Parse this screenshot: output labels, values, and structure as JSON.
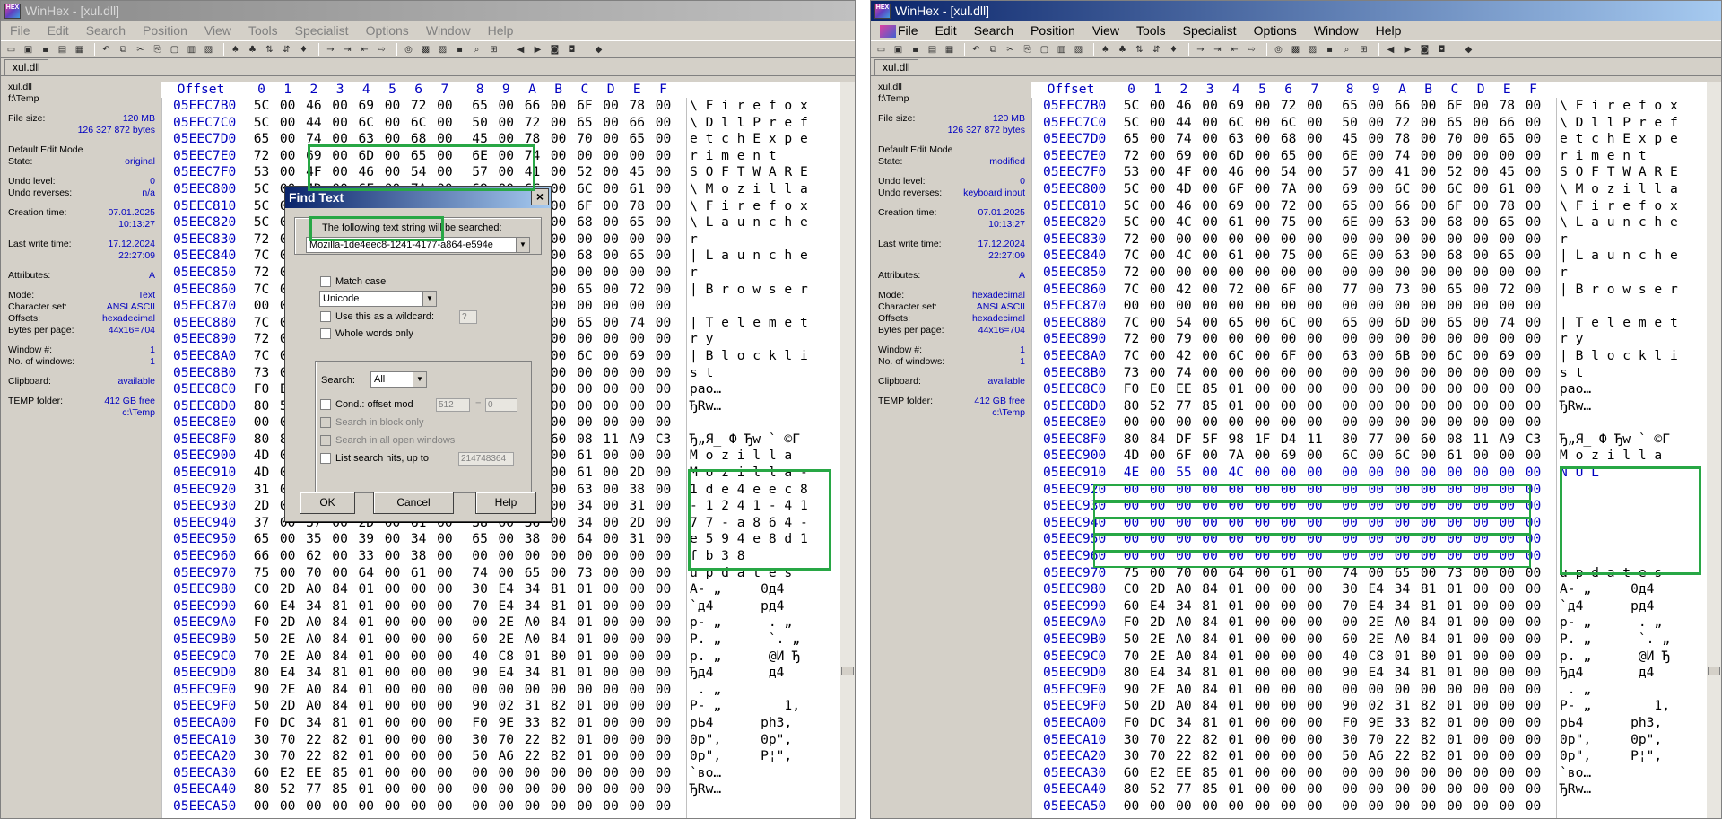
{
  "left": {
    "title": "WinHex - [xul.dll]",
    "menu": [
      "File",
      "Edit",
      "Search",
      "Position",
      "View",
      "Tools",
      "Specialist",
      "Options",
      "Window",
      "Help"
    ],
    "tab": "xul.dll",
    "info": {
      "file": "xul.dll",
      "folder": "f:\\Temp",
      "file_size_label": "File size:",
      "file_size_mb": "120 MB",
      "file_size_bytes": "126 327 872 bytes",
      "edit_mode_label": "Default Edit Mode",
      "state_label": "State:",
      "state": "original",
      "undo_level_label": "Undo level:",
      "undo_level": "0",
      "undo_reverses_label": "Undo reverses:",
      "undo_reverses": "n/a",
      "creation_label": "Creation time:",
      "creation_date": "07.01.2025",
      "creation_time": "10:13:27",
      "write_label": "Last write time:",
      "write_date": "17.12.2024",
      "write_time": "22:27:09",
      "attributes_label": "Attributes:",
      "attributes": "A",
      "mode_label": "Mode:",
      "mode": "Text",
      "charset_label": "Character set:",
      "charset": "ANSI ASCII",
      "offsets_label": "Offsets:",
      "offsets": "hexadecimal",
      "bpp_label": "Bytes per page:",
      "bpp": "44x16=704",
      "window_label": "Window #:",
      "window": "1",
      "nwin_label": "No. of windows:",
      "nwin": "1",
      "clipboard_label": "Clipboard:",
      "clipboard": "available",
      "temp_label": "TEMP folder:",
      "temp_free": "412 GB free",
      "temp_path": "c:\\Temp"
    },
    "header_offset": "Offset",
    "header_cols": [
      "0",
      "1",
      "2",
      "3",
      "4",
      "5",
      "6",
      "7",
      "8",
      "9",
      "A",
      "B",
      "C",
      "D",
      "E",
      "F"
    ],
    "rows": [
      {
        "off": "05EEC7B0",
        "hex": "5C 00 46 00 69 00 72 00 65 00 66 00 6F 00 78 00",
        "txt": "\\ F i r e f o x"
      },
      {
        "off": "05EEC7C0",
        "hex": "5C 00 44 00 6C 00 6C 00 50 00 72 00 65 00 66 00",
        "txt": "\\ D l l P r e f"
      },
      {
        "off": "05EEC7D0",
        "hex": "65 00 74 00 63 00 68 00 45 00 78 00 70 00 65 00",
        "txt": "e t c h E x p e"
      },
      {
        "off": "05EEC7E0",
        "hex": "72 00 69 00 6D 00 65 00 6E 00 74 00 00 00 00 00",
        "txt": "r i m e n t"
      },
      {
        "off": "05EEC7F0",
        "hex": "53 00 4F 00 46 00 54 00 57 00 41 00 52 00 45 00",
        "txt": "S O F T W A R E"
      },
      {
        "off": "05EEC800",
        "hex": "5C 00 4D 00 6F 00 7A 00 69 00 6C 00 6C 00 61 00",
        "txt": "\\ M o z i l l a"
      },
      {
        "off": "05EEC810",
        "hex": "5C 00 46 00 69 00 72 00 65 00 66 00 6F 00 78 00",
        "txt": "\\ F i r e f o x"
      },
      {
        "off": "05EEC820",
        "hex": "5C 00 4C 00 61 00 75 00 6E 00 63 00 68 00 65 00",
        "txt": "\\ L a u n c h e"
      },
      {
        "off": "05EEC830",
        "hex": "72 00 00 00 00 00 00 00 00 00 00 00 00 00 00 00",
        "txt": "r"
      },
      {
        "off": "05EEC840",
        "hex": "7C 00 4C 00 61 00 75 00 6E 00 63 00 68 00 65 00",
        "txt": "| L a u n c h e"
      },
      {
        "off": "05EEC850",
        "hex": "72 00 00 00 00 00 00 00 00 00 00 00 00 00 00 00",
        "txt": "r"
      },
      {
        "off": "05EEC860",
        "hex": "7C 00 42 00 72 00 6F 00 77 00 73 00 65 00 72 00",
        "txt": "| B r o w s e r"
      },
      {
        "off": "05EEC870",
        "hex": "00 00 00 00 00 00 00 00 00 00 00 00 00 00 00 00",
        "txt": ""
      },
      {
        "off": "05EEC880",
        "hex": "7C 00 54 00 65 00 6C 00 65 00 6D 00 65 00 74 00",
        "txt": "| T e l e m e t"
      },
      {
        "off": "05EEC890",
        "hex": "72 00 79 00 00 00 00 00 00 00 00 00 00 00 00 00",
        "txt": "r y"
      },
      {
        "off": "05EEC8A0",
        "hex": "7C 00 42 00 6C 00 6F 00 63 00 6B 00 6C 00 69 00",
        "txt": "| B l o c k l i"
      },
      {
        "off": "05EEC8B0",
        "hex": "73 00 74 00 00 00 00 00 00 00 00 00 00 00 00 00",
        "txt": "s t"
      },
      {
        "off": "05EEC8C0",
        "hex": "F0 E0 EE 85 01 00 00 00 00 00 00 00 00 00 00 00",
        "txt": "pao…"
      },
      {
        "off": "05EEC8D0",
        "hex": "80 52 77 85 01 00 00 00 00 00 00 00 00 00 00 00",
        "txt": "ЂRw…"
      },
      {
        "off": "05EEC8E0",
        "hex": "00 00 00 00 00 00 00 00 00 00 00 00 00 00 00 00",
        "txt": ""
      },
      {
        "off": "05EEC8F0",
        "hex": "80 84 DF 5F 98 1F D4 11 80 77 00 60 08 11 A9 C3",
        "txt": "Ђ„Я_ Ф Ђw ` ©Г"
      },
      {
        "off": "05EEC900",
        "hex": "4D 00 6F 00 7A 00 69 00 6C 00 6C 00 61 00 00 00",
        "txt": "M o z i l l a"
      },
      {
        "off": "05EEC910",
        "hex": "4D 00 6F 00 7A 00 69 00 6C 00 6C 00 61 00 2D 00",
        "txt": "M o z i l l a -"
      },
      {
        "off": "05EEC920",
        "hex": "31 00 64 00 65 00 34 00 65 00 65 00 63 00 38 00",
        "txt": "1 d e 4 e e c 8"
      },
      {
        "off": "05EEC930",
        "hex": "2D 00 31 00 32 00 34 00 31 00 2D 00 34 00 31 00",
        "txt": "- 1 2 4 1 - 4 1"
      },
      {
        "off": "05EEC940",
        "hex": "37 00 37 00 2D 00 61 00 38 00 36 00 34 00 2D 00",
        "txt": "7 7 - a 8 6 4 -"
      },
      {
        "off": "05EEC950",
        "hex": "65 00 35 00 39 00 34 00 65 00 38 00 64 00 31 00",
        "txt": "e 5 9 4 e 8 d 1"
      },
      {
        "off": "05EEC960",
        "hex": "66 00 62 00 33 00 38 00 00 00 00 00 00 00 00 00",
        "txt": "f b 3 8"
      },
      {
        "off": "05EEC970",
        "hex": "75 00 70 00 64 00 61 00 74 00 65 00 73 00 00 00",
        "txt": "u p d a t e s"
      },
      {
        "off": "05EEC980",
        "hex": "C0 2D A0 84 01 00 00 00 30 E4 34 81 01 00 00 00",
        "txt": "А- „     0д4"
      },
      {
        "off": "05EEC990",
        "hex": "60 E4 34 81 01 00 00 00 70 E4 34 81 01 00 00 00",
        "txt": "`д4      рд4"
      },
      {
        "off": "05EEC9A0",
        "hex": "F0 2D A0 84 01 00 00 00 00 2E A0 84 01 00 00 00",
        "txt": "р- „      . „"
      },
      {
        "off": "05EEC9B0",
        "hex": "50 2E A0 84 01 00 00 00 60 2E A0 84 01 00 00 00",
        "txt": "P. „      `. „"
      },
      {
        "off": "05EEC9C0",
        "hex": "70 2E A0 84 01 00 00 00 40 C8 01 80 01 00 00 00",
        "txt": "p. „      @И Ђ"
      },
      {
        "off": "05EEC9D0",
        "hex": "80 E4 34 81 01 00 00 00 90 E4 34 81 01 00 00 00",
        "txt": "Ђд4       д4"
      },
      {
        "off": "05EEC9E0",
        "hex": "90 2E A0 84 01 00 00 00 00 00 00 00 00 00 00 00",
        "txt": " . „"
      },
      {
        "off": "05EEC9F0",
        "hex": "50 2D A0 84 01 00 00 00 90 02 31 82 01 00 00 00",
        "txt": "P- „        1,"
      },
      {
        "off": "05EECA00",
        "hex": "F0 DC 34 81 01 00 00 00 F0 9E 33 82 01 00 00 00",
        "txt": "рЬ4      рh3,"
      },
      {
        "off": "05EECA10",
        "hex": "30 70 22 82 01 00 00 00 30 70 22 82 01 00 00 00",
        "txt": "0p\",     0p\","
      },
      {
        "off": "05EECA20",
        "hex": "30 70 22 82 01 00 00 00 50 A6 22 82 01 00 00 00",
        "txt": "0p\",     P¦\","
      },
      {
        "off": "05EECA30",
        "hex": "60 E2 EE 85 01 00 00 00 00 00 00 00 00 00 00 00",
        "txt": "`во…"
      },
      {
        "off": "05EECA40",
        "hex": "80 52 77 85 01 00 00 00 00 00 00 00 00 00 00 00",
        "txt": "ЂRw…"
      },
      {
        "off": "05EECA50",
        "hex": "00 00 00 00 00 00 00 00 00 00 00 00 00 00 00 00",
        "txt": ""
      }
    ],
    "dialog": {
      "title": "Find Text",
      "close": "×",
      "prompt": "The following text string will be searched:",
      "search_value": "Mozilla-1de4eec8-1241-4177-a864-e594e",
      "match_case": "Match case",
      "encoding": "Unicode",
      "wildcard": "Use this as a wildcard:",
      "wildcard_char": "?",
      "whole_words": "Whole words only",
      "search_label": "Search:",
      "search_scope": "All",
      "cond_offset": "Cond.: offset mod",
      "cond_mod": "512",
      "cond_eq": "=",
      "cond_val": "0",
      "search_block": "Search in block only",
      "search_all_windows": "Search in all open windows",
      "list_hits": "List search hits, up to",
      "list_max": "214748364",
      "ok": "OK",
      "cancel": "Cancel",
      "help": "Help"
    }
  },
  "right": {
    "title": "WinHex - [xul.dll]",
    "menu": [
      "File",
      "Edit",
      "Search",
      "Position",
      "View",
      "Tools",
      "Specialist",
      "Options",
      "Window",
      "Help"
    ],
    "tab": "xul.dll",
    "info": {
      "file": "xul.dll",
      "folder": "f:\\Temp",
      "file_size_label": "File size:",
      "file_size_mb": "120 MB",
      "file_size_bytes": "126 327 872 bytes",
      "edit_mode_label": "Default Edit Mode",
      "state_label": "State:",
      "state": "modified",
      "undo_level_label": "Undo level:",
      "undo_level": "0",
      "undo_reverses_label": "Undo reverses:",
      "undo_reverses": "keyboard input",
      "creation_label": "Creation time:",
      "creation_date": "07.01.2025",
      "creation_time": "10:13:27",
      "write_label": "Last write time:",
      "write_date": "17.12.2024",
      "write_time": "22:27:09",
      "attributes_label": "Attributes:",
      "attributes": "A",
      "mode_label": "Mode:",
      "mode": "hexadecimal",
      "charset_label": "Character set:",
      "charset": "ANSI ASCII",
      "offsets_label": "Offsets:",
      "offsets": "hexadecimal",
      "bpp_label": "Bytes per page:",
      "bpp": "44x16=704",
      "window_label": "Window #:",
      "window": "1",
      "nwin_label": "No. of windows:",
      "nwin": "1",
      "clipboard_label": "Clipboard:",
      "clipboard": "available",
      "temp_label": "TEMP folder:",
      "temp_free": "412 GB free",
      "temp_path": "c:\\Temp"
    },
    "header_offset": "Offset",
    "header_cols": [
      "0",
      "1",
      "2",
      "3",
      "4",
      "5",
      "6",
      "7",
      "8",
      "9",
      "A",
      "B",
      "C",
      "D",
      "E",
      "F"
    ],
    "rows": [
      {
        "off": "05EEC7B0",
        "hex": "5C 00 46 00 69 00 72 00 65 00 66 00 6F 00 78 00",
        "txt": "\\ F i r e f o x"
      },
      {
        "off": "05EEC7C0",
        "hex": "5C 00 44 00 6C 00 6C 00 50 00 72 00 65 00 66 00",
        "txt": "\\ D l l P r e f"
      },
      {
        "off": "05EEC7D0",
        "hex": "65 00 74 00 63 00 68 00 45 00 78 00 70 00 65 00",
        "txt": "e t c h E x p e"
      },
      {
        "off": "05EEC7E0",
        "hex": "72 00 69 00 6D 00 65 00 6E 00 74 00 00 00 00 00",
        "txt": "r i m e n t"
      },
      {
        "off": "05EEC7F0",
        "hex": "53 00 4F 00 46 00 54 00 57 00 41 00 52 00 45 00",
        "txt": "S O F T W A R E"
      },
      {
        "off": "05EEC800",
        "hex": "5C 00 4D 00 6F 00 7A 00 69 00 6C 00 6C 00 61 00",
        "txt": "\\ M o z i l l a"
      },
      {
        "off": "05EEC810",
        "hex": "5C 00 46 00 69 00 72 00 65 00 66 00 6F 00 78 00",
        "txt": "\\ F i r e f o x"
      },
      {
        "off": "05EEC820",
        "hex": "5C 00 4C 00 61 00 75 00 6E 00 63 00 68 00 65 00",
        "txt": "\\ L a u n c h e"
      },
      {
        "off": "05EEC830",
        "hex": "72 00 00 00 00 00 00 00 00 00 00 00 00 00 00 00",
        "txt": "r"
      },
      {
        "off": "05EEC840",
        "hex": "7C 00 4C 00 61 00 75 00 6E 00 63 00 68 00 65 00",
        "txt": "| L a u n c h e"
      },
      {
        "off": "05EEC850",
        "hex": "72 00 00 00 00 00 00 00 00 00 00 00 00 00 00 00",
        "txt": "r"
      },
      {
        "off": "05EEC860",
        "hex": "7C 00 42 00 72 00 6F 00 77 00 73 00 65 00 72 00",
        "txt": "| B r o w s e r"
      },
      {
        "off": "05EEC870",
        "hex": "00 00 00 00 00 00 00 00 00 00 00 00 00 00 00 00",
        "txt": ""
      },
      {
        "off": "05EEC880",
        "hex": "7C 00 54 00 65 00 6C 00 65 00 6D 00 65 00 74 00",
        "txt": "| T e l e m e t"
      },
      {
        "off": "05EEC890",
        "hex": "72 00 79 00 00 00 00 00 00 00 00 00 00 00 00 00",
        "txt": "r y"
      },
      {
        "off": "05EEC8A0",
        "hex": "7C 00 42 00 6C 00 6F 00 63 00 6B 00 6C 00 69 00",
        "txt": "| B l o c k l i"
      },
      {
        "off": "05EEC8B0",
        "hex": "73 00 74 00 00 00 00 00 00 00 00 00 00 00 00 00",
        "txt": "s t"
      },
      {
        "off": "05EEC8C0",
        "hex": "F0 E0 EE 85 01 00 00 00 00 00 00 00 00 00 00 00",
        "txt": "pao…"
      },
      {
        "off": "05EEC8D0",
        "hex": "80 52 77 85 01 00 00 00 00 00 00 00 00 00 00 00",
        "txt": "ЂRw…"
      },
      {
        "off": "05EEC8E0",
        "hex": "00 00 00 00 00 00 00 00 00 00 00 00 00 00 00 00",
        "txt": ""
      },
      {
        "off": "05EEC8F0",
        "hex": "80 84 DF 5F 98 1F D4 11 80 77 00 60 08 11 A9 C3",
        "txt": "Ђ„Я_ Ф Ђw ` ©Г"
      },
      {
        "off": "05EEC900",
        "hex": "4D 00 6F 00 7A 00 69 00 6C 00 6C 00 61 00 00 00",
        "txt": "M o z i l l a"
      },
      {
        "off": "05EEC910",
        "hex": "4E 00 55 00 4C 00 00 00 00 00 00 00 00 00 00 00",
        "txt": "N U L",
        "blue_from": 0
      },
      {
        "off": "05EEC920",
        "hex": "00 00 00 00 00 00 00 00 00 00 00 00 00 00 00 00",
        "txt": "",
        "blue_from": 0
      },
      {
        "off": "05EEC930",
        "hex": "00 00 00 00 00 00 00 00 00 00 00 00 00 00 00 00",
        "txt": "",
        "blue_from": 0
      },
      {
        "off": "05EEC940",
        "hex": "00 00 00 00 00 00 00 00 00 00 00 00 00 00 00 00",
        "txt": "",
        "blue_from": 0
      },
      {
        "off": "05EEC950",
        "hex": "00 00 00 00 00 00 00 00 00 00 00 00 00 00 00 00",
        "txt": "",
        "blue_from": 0
      },
      {
        "off": "05EEC960",
        "hex": "00 00 00 00 00 00 00 00 00 00 00 00 00 00 00 00",
        "txt": "",
        "blue_from": 0
      },
      {
        "off": "05EEC970",
        "hex": "75 00 70 00 64 00 61 00 74 00 65 00 73 00 00 00",
        "txt": "u p d a t e s"
      },
      {
        "off": "05EEC980",
        "hex": "C0 2D A0 84 01 00 00 00 30 E4 34 81 01 00 00 00",
        "txt": "А- „     0д4"
      },
      {
        "off": "05EEC990",
        "hex": "60 E4 34 81 01 00 00 00 70 E4 34 81 01 00 00 00",
        "txt": "`д4      рд4"
      },
      {
        "off": "05EEC9A0",
        "hex": "F0 2D A0 84 01 00 00 00 00 2E A0 84 01 00 00 00",
        "txt": "р- „      . „"
      },
      {
        "off": "05EEC9B0",
        "hex": "50 2E A0 84 01 00 00 00 60 2E A0 84 01 00 00 00",
        "txt": "P. „      `. „"
      },
      {
        "off": "05EEC9C0",
        "hex": "70 2E A0 84 01 00 00 00 40 C8 01 80 01 00 00 00",
        "txt": "p. „      @И Ђ"
      },
      {
        "off": "05EEC9D0",
        "hex": "80 E4 34 81 01 00 00 00 90 E4 34 81 01 00 00 00",
        "txt": "Ђд4       д4"
      },
      {
        "off": "05EEC9E0",
        "hex": "90 2E A0 84 01 00 00 00 00 00 00 00 00 00 00 00",
        "txt": " . „"
      },
      {
        "off": "05EEC9F0",
        "hex": "50 2D A0 84 01 00 00 00 90 02 31 82 01 00 00 00",
        "txt": "P- „        1,"
      },
      {
        "off": "05EECA00",
        "hex": "F0 DC 34 81 01 00 00 00 F0 9E 33 82 01 00 00 00",
        "txt": "рЬ4      рh3,"
      },
      {
        "off": "05EECA10",
        "hex": "30 70 22 82 01 00 00 00 30 70 22 82 01 00 00 00",
        "txt": "0p\",     0p\","
      },
      {
        "off": "05EECA20",
        "hex": "30 70 22 82 01 00 00 00 50 A6 22 82 01 00 00 00",
        "txt": "0p\",     P¦\","
      },
      {
        "off": "05EECA30",
        "hex": "60 E2 EE 85 01 00 00 00 00 00 00 00 00 00 00 00",
        "txt": "`во…"
      },
      {
        "off": "05EECA40",
        "hex": "80 52 77 85 01 00 00 00 00 00 00 00 00 00 00 00",
        "txt": "ЂRw…"
      },
      {
        "off": "05EECA50",
        "hex": "00 00 00 00 00 00 00 00 00 00 00 00 00 00 00 00",
        "txt": ""
      }
    ]
  },
  "colors": {
    "highlight": "#28a745",
    "offset_blue": "#0000c0",
    "title_active": "#0a246a"
  },
  "toolbar_icons": [
    "new-file-icon",
    "open-file-icon",
    "save-icon",
    "print-icon",
    "properties-icon",
    "copy-icon",
    "undo-icon",
    "cut-icon",
    "copy-block-icon",
    "paste-icon",
    "paste-special-icon",
    "write-icon",
    "find-text-icon",
    "find-hex-icon",
    "replace-text-icon",
    "replace-hex-icon",
    "find-next-icon",
    "goto-offset-icon",
    "goto-page-icon",
    "back-icon",
    "forward-icon",
    "open-disk-icon",
    "ram-icon",
    "hash-icon",
    "calculator-icon",
    "search-icon",
    "directory-icon",
    "prev-icon",
    "next-icon",
    "camera-icon",
    "snapshot-icon",
    "book-icon"
  ]
}
